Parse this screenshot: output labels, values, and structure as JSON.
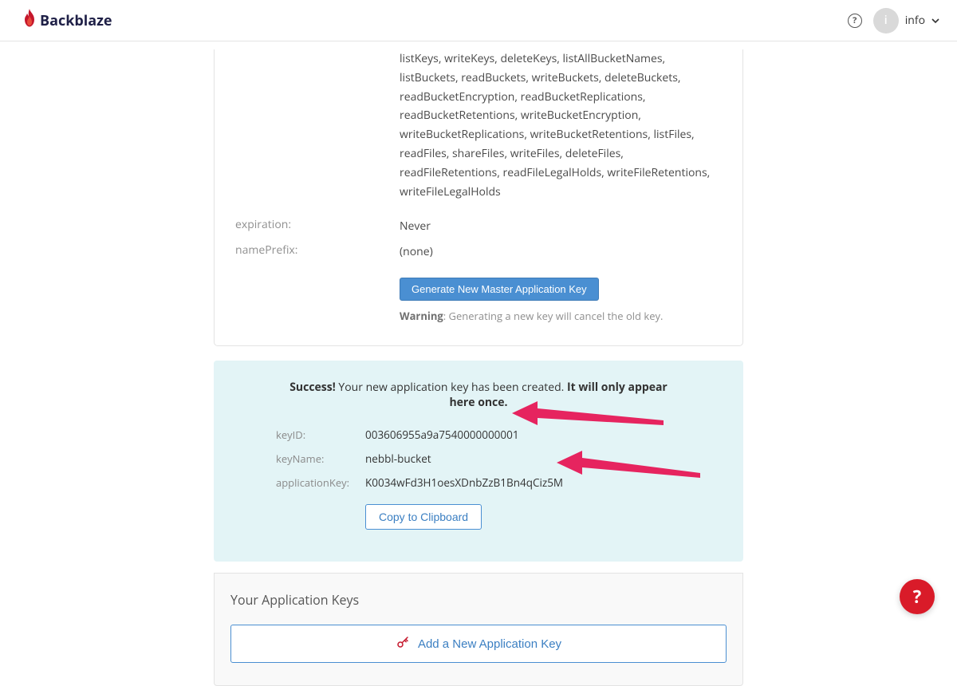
{
  "header": {
    "brand": "Backblaze",
    "user_label": "info"
  },
  "master_key": {
    "capabilities": "listKeys, writeKeys, deleteKeys, listAllBucketNames, listBuckets, readBuckets, writeBuckets, deleteBuckets, readBucketEncryption, readBucketReplications, readBucketRetentions, writeBucketEncryption, writeBucketReplications, writeBucketRetentions, listFiles, readFiles, shareFiles, writeFiles, deleteFiles, readFileRetentions, readFileLegalHolds, writeFileRetentions, writeFileLegalHolds",
    "expiration_label": "expiration:",
    "expiration_value": "Never",
    "name_prefix_label": "namePrefix:",
    "name_prefix_value": "(none)",
    "generate_button": "Generate New Master Application Key",
    "warning_prefix": "Warning",
    "warning_text": ": Generating a new key will cancel the old key."
  },
  "success": {
    "bold1": "Success!",
    "mid": " Your new application key has been created. ",
    "bold2": "It will only appear here once.",
    "keyid_label": "keyID:",
    "keyid_value": "003606955a9a7540000000001",
    "keyname_label": "keyName:",
    "keyname_value": "nebbl-bucket",
    "appkey_label": "applicationKey:",
    "appkey_value": "K0034wFd3H1oesXDnbZzB1Bn4qCiz5M",
    "copy_button": "Copy to Clipboard"
  },
  "your_keys": {
    "title": "Your Application Keys",
    "add_button": "Add a New Application Key"
  }
}
